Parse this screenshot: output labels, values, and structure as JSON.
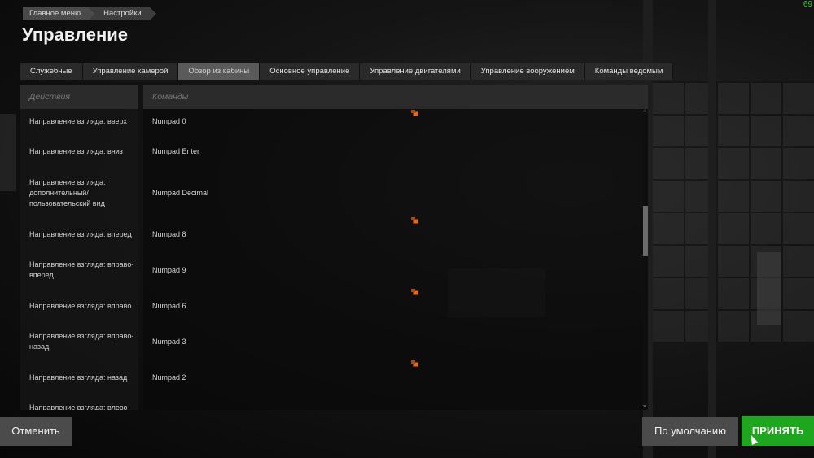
{
  "fps": "69",
  "breadcrumb": [
    "Главное меню",
    "Настройки"
  ],
  "page_title": "Управление",
  "tabs": [
    {
      "label": "Служебные",
      "active": false
    },
    {
      "label": "Управление камерой",
      "active": false
    },
    {
      "label": "Обзор из кабины",
      "active": true
    },
    {
      "label": "Основное управление",
      "active": false
    },
    {
      "label": "Управление двигателями",
      "active": false
    },
    {
      "label": "Управление вооружением",
      "active": false
    },
    {
      "label": "Команды ведомым",
      "active": false
    }
  ],
  "table": {
    "header_actions": "Действия",
    "header_commands": "Команды",
    "rows": [
      {
        "action": "Направление взгляда: вверх",
        "command": "Numpad 0",
        "mark": "above"
      },
      {
        "action": "Направление взгляда: вниз",
        "command": "Numpad Enter",
        "mark": ""
      },
      {
        "action": "Направление взгляда: дополнительный/пользовательский вид",
        "command": "Numpad Decimal",
        "mark": ""
      },
      {
        "action": "Направление взгляда: вперед",
        "command": "Numpad 8",
        "mark": "above"
      },
      {
        "action": "Направление взгляда: вправо-вперед",
        "command": "Numpad 9",
        "mark": ""
      },
      {
        "action": "Направление взгляда: вправо",
        "command": "Numpad 6",
        "mark": "above"
      },
      {
        "action": "Направление взгляда: вправо-назад",
        "command": "Numpad 3",
        "mark": ""
      },
      {
        "action": "Направление взгляда: назад",
        "command": "Numpad 2",
        "mark": "above"
      },
      {
        "action": "Направление взгляда: влево-",
        "command": "",
        "mark": ""
      }
    ]
  },
  "scroll": {
    "position": 0.38,
    "visible_fraction": 0.18
  },
  "buttons": {
    "cancel": "Отменить",
    "default": "По умолчанию",
    "accept": "ПРИНЯТЬ"
  },
  "colors": {
    "accent_green": "#1ea71e",
    "mark_orange": "#e86a16"
  }
}
